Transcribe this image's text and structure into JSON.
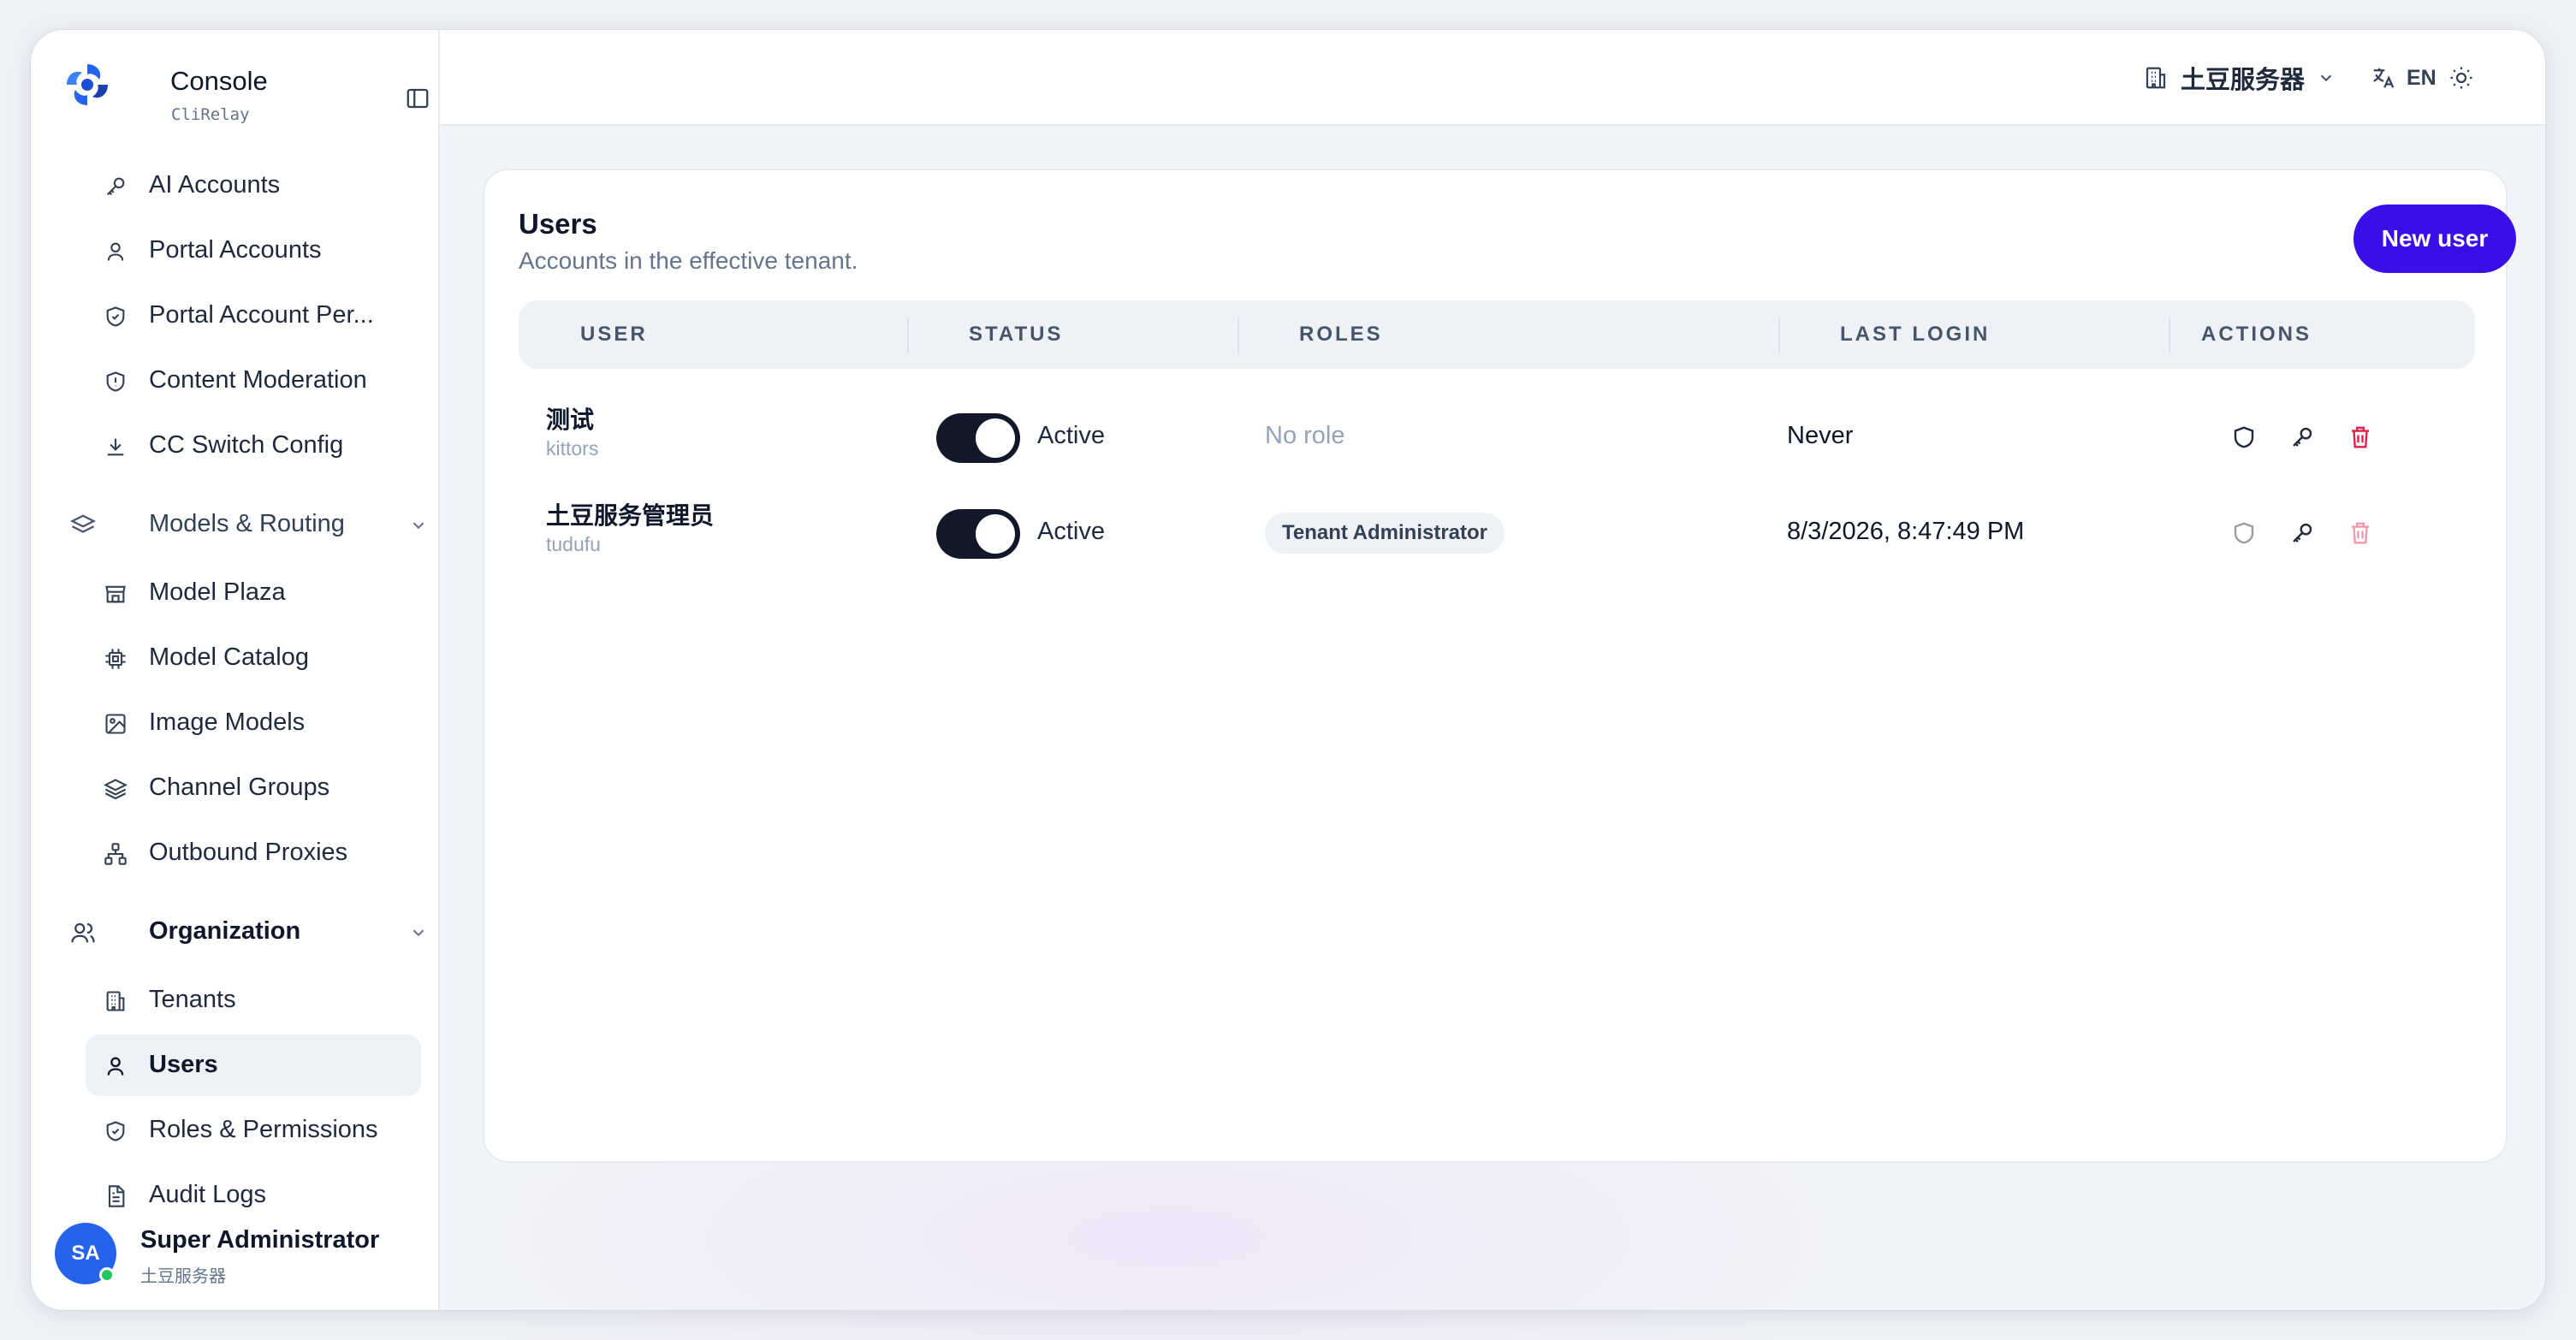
{
  "brand": {
    "title": "Console",
    "subtitle": "CliRelay"
  },
  "sidebar": {
    "top_items": [
      {
        "label": "AI Accounts",
        "icon": "key-icon"
      },
      {
        "label": "Portal Accounts",
        "icon": "user-icon"
      },
      {
        "label": "Portal Account Per...",
        "icon": "shield-check-icon"
      },
      {
        "label": "Content Moderation",
        "icon": "shield-alert-icon"
      },
      {
        "label": "CC Switch Config",
        "icon": "download-icon"
      }
    ],
    "groups": [
      {
        "label": "Models & Routing",
        "icon": "layers-icon",
        "expanded": true,
        "items": [
          {
            "label": "Model Plaza",
            "icon": "store-icon"
          },
          {
            "label": "Model Catalog",
            "icon": "cpu-icon"
          },
          {
            "label": "Image Models",
            "icon": "image-icon"
          },
          {
            "label": "Channel Groups",
            "icon": "layers-icon"
          },
          {
            "label": "Outbound Proxies",
            "icon": "network-icon"
          }
        ]
      },
      {
        "label": "Organization",
        "icon": "users-icon",
        "expanded": true,
        "items": [
          {
            "label": "Tenants",
            "icon": "building-icon"
          },
          {
            "label": "Users",
            "icon": "user-icon",
            "active": true
          },
          {
            "label": "Roles & Permissions",
            "icon": "shield-check-icon"
          },
          {
            "label": "Audit Logs",
            "icon": "file-text-icon"
          }
        ]
      }
    ]
  },
  "profile": {
    "initials": "SA",
    "name": "Super Administrator",
    "tenant": "土豆服务器",
    "online": true
  },
  "topbar": {
    "tenant": "土豆服务器",
    "language": "EN",
    "theme_icon": "sun-icon"
  },
  "page": {
    "title": "Users",
    "subtitle": "Accounts in the effective tenant.",
    "new_button": "New user"
  },
  "table": {
    "headers": [
      "USER",
      "STATUS",
      "ROLES",
      "LAST LOGIN",
      "ACTIONS"
    ],
    "rows": [
      {
        "name": "测试",
        "login": "kittors",
        "active": true,
        "status": "Active",
        "role": "No role",
        "role_assigned": false,
        "last_login": "Never",
        "actions_enabled": true
      },
      {
        "name": "土豆服务管理员",
        "login": "tudufu",
        "active": true,
        "status": "Active",
        "role": "Tenant Administrator",
        "role_assigned": true,
        "last_login": "8/3/2026, 8:47:49 PM",
        "actions_enabled": false
      }
    ]
  },
  "colors": {
    "accent": "#3b0ee8",
    "avatar": "#2563eb",
    "danger": "#e11d48",
    "toggle_on": "#111827",
    "online": "#22c55e"
  }
}
